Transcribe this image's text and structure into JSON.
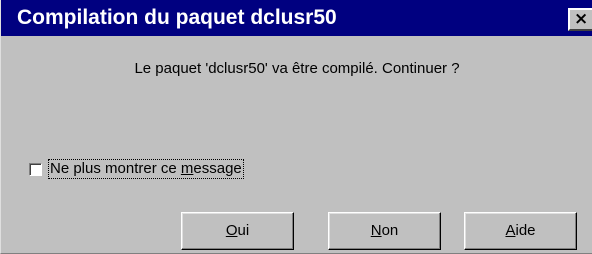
{
  "window": {
    "title": "Compilation du paquet dclusr50",
    "close_glyph": "×",
    "close_icon": "close-icon"
  },
  "dialog": {
    "message": "Le paquet 'dclusr50' va être compilé.  Continuer ?",
    "checkbox": {
      "label": "Ne plus montrer ce message",
      "checked": false
    }
  },
  "buttons": {
    "yes": {
      "label": "Oui",
      "mnemonic": "O"
    },
    "no": {
      "label": "Non",
      "mnemonic": "N"
    },
    "help": {
      "label": "Aide",
      "mnemonic": "A"
    }
  },
  "colors": {
    "titlebar": "#000080",
    "face": "#c0c0c0",
    "title_text": "#ffffff"
  }
}
